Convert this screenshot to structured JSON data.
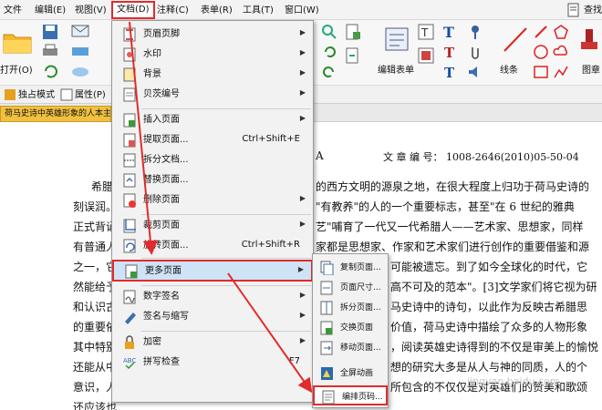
{
  "menubar": {
    "items": [
      "文件",
      "编辑(E)",
      "视图(V)",
      "文档(D)",
      "注释(C)",
      "表单(R)",
      "工具(T)",
      "窗口(W)"
    ],
    "right_label": "查找"
  },
  "ribbon": {
    "open_label": "打开(O)",
    "edit_form_label": "编辑表单",
    "line_label": "线条",
    "shape_label": "图章"
  },
  "toolbar2": {
    "exclusive_mode": "独占模式",
    "properties": "属性(P)"
  },
  "tab": {
    "title": "荷马史诗中英雄形象的人本主"
  },
  "document": {
    "header_letter": "A",
    "article_no": "文 章 编 号： 1008-2646(2010)05-50-04",
    "lines": [
      "希腊的",
      "刻误润。",
      "正式背诵",
      "有普通人",
      "之一，它",
      "然能给予",
      "和认识古",
      "的重要依",
      "其中特别",
      "还能从中",
      "意识，人",
      "还应该也"
    ],
    "right_lines": [
      "的西方文明的源泉之地，在很大程度上归功于荷马史诗的",
      "\"有教养\"的人的一个重要标志，甚至\"在 6 世纪的雅典",
      "艺\"哺育了一代又一代希腊人——艺术家、思想家，同样",
      "家都是思想家、作家和艺术家们进行创作的重要借鉴和源",
      "可能被遗忘。到了如今全球化的时代，它",
      "高不可及的范本\"。[3]文学家们将它视为研",
      "马史诗中的诗句，以此作为反映古希腊思",
      "价值，荷马史诗中描绘了众多的人物形象",
      "，阅读英雄史诗得到的不仅是审美上的愉悦",
      "想的研究大多是从人与神的同质，人的个",
      "所包含的不仅仅是对英雄们的赞美和歌颂",
      ""
    ]
  },
  "doc_menu": {
    "items": [
      {
        "label": "页眉页脚",
        "shortcut": "",
        "submenu": true
      },
      {
        "label": "水印",
        "shortcut": "",
        "submenu": true
      },
      {
        "label": "背景",
        "shortcut": "",
        "submenu": true
      },
      {
        "label": "贝茨编号",
        "shortcut": "",
        "submenu": true
      },
      {
        "label": "插入页面",
        "shortcut": "",
        "submenu": true
      },
      {
        "label": "提取页面...",
        "shortcut": "Ctrl+Shift+E",
        "submenu": false
      },
      {
        "label": "拆分文档...",
        "shortcut": "",
        "submenu": false
      },
      {
        "label": "替换页面...",
        "shortcut": "",
        "submenu": false
      },
      {
        "label": "删除页面",
        "shortcut": "",
        "submenu": true
      },
      {
        "label": "裁剪页面",
        "shortcut": "",
        "submenu": true
      },
      {
        "label": "旋转页面...",
        "shortcut": "Ctrl+Shift+R",
        "submenu": false
      },
      {
        "label": "更多页面",
        "shortcut": "",
        "submenu": true
      },
      {
        "label": "数字签名",
        "shortcut": "",
        "submenu": true
      },
      {
        "label": "签名与缩写",
        "shortcut": "",
        "submenu": true
      },
      {
        "label": "加密",
        "shortcut": "",
        "submenu": true
      },
      {
        "label": "拼写检查",
        "shortcut": "F7",
        "submenu": false
      }
    ]
  },
  "more_pages_submenu": {
    "items": [
      "复制页面...",
      "页面尺寸...",
      "拆分页面...",
      "交换页面",
      "移动页面...",
      "全屏动画",
      "编排页码..."
    ]
  },
  "watermark_text": "jingyan.baidu.com",
  "colors": {
    "highlight_border": "#e22b2b",
    "menu_bg": "#f2f2f2",
    "selected_bg": "#cfe3f7",
    "tab_bg": "#f0c040"
  }
}
